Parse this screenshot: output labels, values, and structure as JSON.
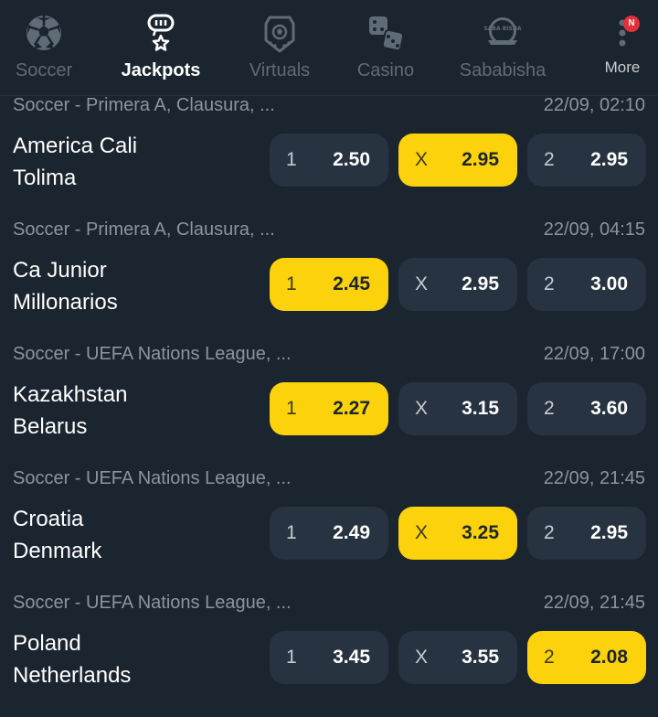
{
  "nav": {
    "items": [
      {
        "label": "Soccer",
        "icon": "soccer-ball-icon"
      },
      {
        "label": "Jackpots",
        "icon": "jackpot-icon"
      },
      {
        "label": "Virtuals",
        "icon": "virtuals-icon"
      },
      {
        "label": "Casino",
        "icon": "dice-icon"
      },
      {
        "label": "Sababisha",
        "icon": "sababisha-icon",
        "icon_text": "SABA BISHA"
      },
      {
        "label": "More",
        "icon": "more-vertical-icon",
        "badge": "N"
      }
    ],
    "active": "Jackpots"
  },
  "matches": [
    {
      "league": "Soccer - Primera A, Clausura, ...",
      "time": "22/09, 02:10",
      "home": "America Cali",
      "away": "Tolima",
      "odds": [
        {
          "label": "1",
          "value": "2.50",
          "selected": false
        },
        {
          "label": "X",
          "value": "2.95",
          "selected": true
        },
        {
          "label": "2",
          "value": "2.95",
          "selected": false
        }
      ]
    },
    {
      "league": "Soccer - Primera A, Clausura, ...",
      "time": "22/09, 04:15",
      "home": "Ca Junior",
      "away": "Millonarios",
      "odds": [
        {
          "label": "1",
          "value": "2.45",
          "selected": true
        },
        {
          "label": "X",
          "value": "2.95",
          "selected": false
        },
        {
          "label": "2",
          "value": "3.00",
          "selected": false
        }
      ]
    },
    {
      "league": "Soccer - UEFA Nations League, ...",
      "time": "22/09, 17:00",
      "home": "Kazakhstan",
      "away": "Belarus",
      "odds": [
        {
          "label": "1",
          "value": "2.27",
          "selected": true
        },
        {
          "label": "X",
          "value": "3.15",
          "selected": false
        },
        {
          "label": "2",
          "value": "3.60",
          "selected": false
        }
      ]
    },
    {
      "league": "Soccer - UEFA Nations League, ...",
      "time": "22/09, 21:45",
      "home": "Croatia",
      "away": "Denmark",
      "odds": [
        {
          "label": "1",
          "value": "2.49",
          "selected": false
        },
        {
          "label": "X",
          "value": "3.25",
          "selected": true
        },
        {
          "label": "2",
          "value": "2.95",
          "selected": false
        }
      ]
    },
    {
      "league": "Soccer - UEFA Nations League, ...",
      "time": "22/09, 21:45",
      "home": "Poland",
      "away": "Netherlands",
      "odds": [
        {
          "label": "1",
          "value": "3.45",
          "selected": false
        },
        {
          "label": "X",
          "value": "3.55",
          "selected": false
        },
        {
          "label": "2",
          "value": "2.08",
          "selected": true
        }
      ]
    }
  ],
  "colors": {
    "background": "#1b2530",
    "odd_button": "#273340",
    "selected": "#fcd20c",
    "muted_text": "#8a95a0",
    "badge": "#e0303a"
  }
}
